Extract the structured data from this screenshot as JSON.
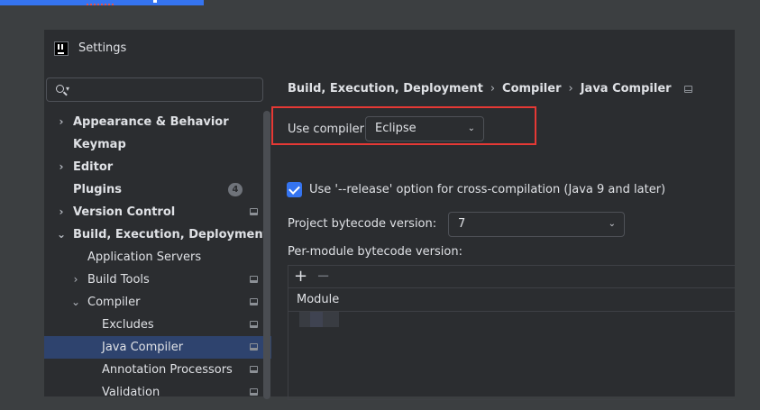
{
  "window": {
    "title": "Settings"
  },
  "search": {
    "placeholder": ""
  },
  "sidebar": {
    "items": [
      {
        "label": "Appearance & Behavior",
        "chevron": ">",
        "bold": true
      },
      {
        "label": "Keymap",
        "bold": true
      },
      {
        "label": "Editor",
        "chevron": ">",
        "bold": true
      },
      {
        "label": "Plugins",
        "bold": true,
        "badge": "4"
      },
      {
        "label": "Version Control",
        "chevron": ">",
        "bold": true
      },
      {
        "label": "Build, Execution, Deployment",
        "chevron": "v",
        "bold": true
      },
      {
        "label": "Application Servers"
      },
      {
        "label": "Build Tools",
        "chevron": ">"
      },
      {
        "label": "Compiler",
        "chevron": "v"
      },
      {
        "label": "Excludes"
      },
      {
        "label": "Java Compiler",
        "selected": true
      },
      {
        "label": "Annotation Processors"
      },
      {
        "label": "Validation"
      }
    ]
  },
  "breadcrumb": [
    "Build, Execution, Deployment",
    "Compiler",
    "Java Compiler"
  ],
  "main": {
    "use_compiler_label": "Use compiler:",
    "use_compiler_value": "Eclipse",
    "release_option_label": "Use '--release' option for cross-compilation (Java 9 and later)",
    "release_option_checked": true,
    "bytecode_label": "Project bytecode version:",
    "bytecode_value": "7",
    "per_module_label": "Per-module bytecode version:",
    "table": {
      "column_header": "Module",
      "rows": []
    }
  },
  "colors": {
    "accent": "#3574f0",
    "highlight": "#e53935",
    "selected": "#2e436e"
  }
}
